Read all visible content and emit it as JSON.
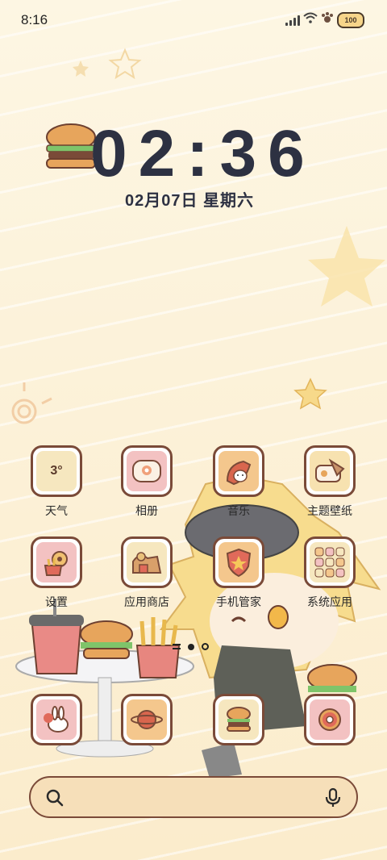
{
  "status_bar": {
    "time": "8:16",
    "battery_label": "100"
  },
  "lock": {
    "clock": "02:36",
    "date": "02月07日 星期六"
  },
  "apps": [
    {
      "label": "天气",
      "icon": "weather-icon",
      "value": "3°"
    },
    {
      "label": "相册",
      "icon": "gallery-icon"
    },
    {
      "label": "音乐",
      "icon": "music-icon"
    },
    {
      "label": "主题壁纸",
      "icon": "theme-wallpaper-icon"
    },
    {
      "label": "设置",
      "icon": "settings-icon"
    },
    {
      "label": "应用商店",
      "icon": "app-store-icon"
    },
    {
      "label": "手机管家",
      "icon": "phone-manager-icon"
    },
    {
      "label": "系统应用",
      "icon": "system-apps-icon"
    }
  ],
  "dock": [
    {
      "icon": "bunny-dock-icon"
    },
    {
      "icon": "planet-dock-icon"
    },
    {
      "icon": "burger-dock-icon"
    },
    {
      "icon": "donut-dock-icon"
    }
  ],
  "colors": {
    "border": "#7a4a38",
    "background": "#fdf3dc",
    "clock": "#2d3142",
    "search": "#f6dfb9"
  }
}
